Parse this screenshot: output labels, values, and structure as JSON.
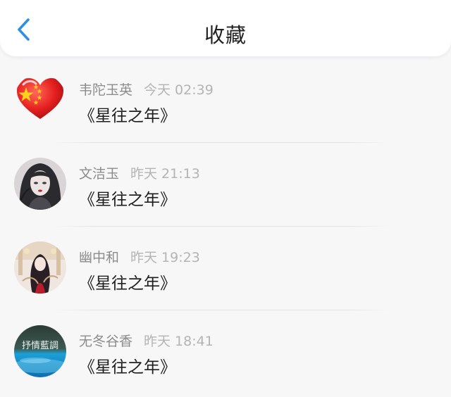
{
  "header": {
    "title": "收藏"
  },
  "colors": {
    "accent": "#2f8fe0",
    "background": "#f7f7f8",
    "name_text": "#8c8c8c",
    "time_text": "#b4b4b4"
  },
  "favorites": [
    {
      "username": "韦陀玉英",
      "time": "今天 02:39",
      "content": "《星往之年》",
      "avatar_icon": "china-flag-heart-icon"
    },
    {
      "username": "文洁玉",
      "time": "昨天 21:13",
      "content": "《星往之年》",
      "avatar_icon": "portrait-avatar"
    },
    {
      "username": "幽中和",
      "time": "昨天 19:23",
      "content": "《星往之年》",
      "avatar_icon": "illustration-avatar"
    },
    {
      "username": "无冬谷香",
      "time": "昨天 18:41",
      "content": "《星往之年》",
      "avatar_icon": "water-scene-avatar",
      "avatar_text": "抒情藍調"
    }
  ]
}
